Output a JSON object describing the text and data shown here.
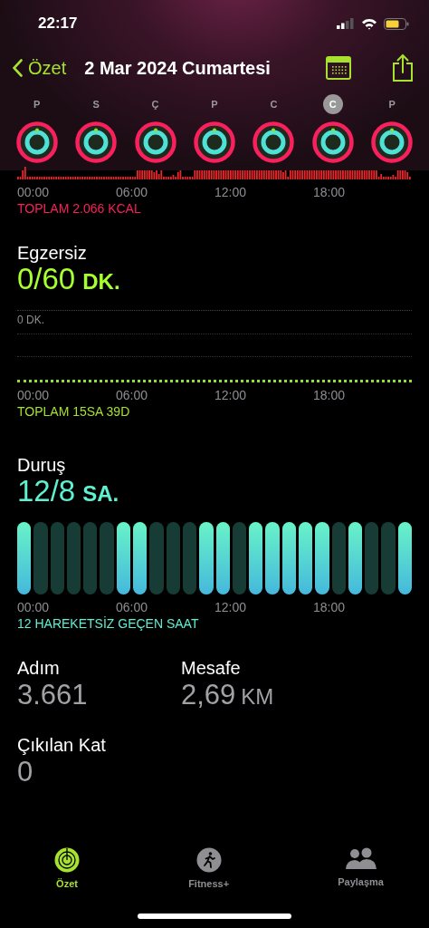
{
  "status_bar": {
    "time": "22:17"
  },
  "nav": {
    "back": "Özet",
    "title": "2 Mar 2024 Cumartesi"
  },
  "days": [
    {
      "label": "P",
      "selected": false
    },
    {
      "label": "S",
      "selected": false
    },
    {
      "label": "Ç",
      "selected": false
    },
    {
      "label": "P",
      "selected": false
    },
    {
      "label": "C",
      "selected": false
    },
    {
      "label": "C",
      "selected": true
    },
    {
      "label": "P",
      "selected": false
    }
  ],
  "move": {
    "time_labels": [
      "00:00",
      "06:00",
      "12:00",
      "18:00"
    ],
    "total": "TOPLAM 2.066 KCAL"
  },
  "exercise": {
    "title": "Egzersiz",
    "value": "0/60",
    "unit": "DK.",
    "axis_label": "0 DK.",
    "time_labels": [
      "00:00",
      "06:00",
      "12:00",
      "18:00"
    ],
    "total": "TOPLAM 15SA 39D"
  },
  "stand": {
    "title": "Duruş",
    "value": "12/8",
    "unit": "SA.",
    "hours": [
      {
        "stood": true
      },
      {
        "stood": false
      },
      {
        "stood": false
      },
      {
        "stood": false
      },
      {
        "stood": false
      },
      {
        "stood": false
      },
      {
        "stood": true
      },
      {
        "stood": true
      },
      {
        "stood": false
      },
      {
        "stood": false
      },
      {
        "stood": false
      },
      {
        "stood": true
      },
      {
        "stood": true
      },
      {
        "stood": false
      },
      {
        "stood": true
      },
      {
        "stood": true
      },
      {
        "stood": true
      },
      {
        "stood": true
      },
      {
        "stood": true
      },
      {
        "stood": false
      },
      {
        "stood": true
      },
      {
        "stood": false
      },
      {
        "stood": false
      },
      {
        "stood": true
      }
    ],
    "time_labels": [
      "00:00",
      "06:00",
      "12:00",
      "18:00"
    ],
    "caption": "12 HAREKETSİZ GEÇEN SAAT"
  },
  "stats": [
    {
      "label": "Adım",
      "value": "3.661"
    },
    {
      "label": "Mesafe",
      "value": "2,69",
      "unit": "KM"
    }
  ],
  "floors": {
    "label": "Çıkılan Kat",
    "value": "0"
  },
  "tab_bar": [
    {
      "label": "Özet",
      "kind": "summary",
      "selected": true
    },
    {
      "label": "Fitness+",
      "kind": "fitness",
      "selected": false
    },
    {
      "label": "Paylaşma",
      "kind": "sharing",
      "selected": false
    }
  ]
}
